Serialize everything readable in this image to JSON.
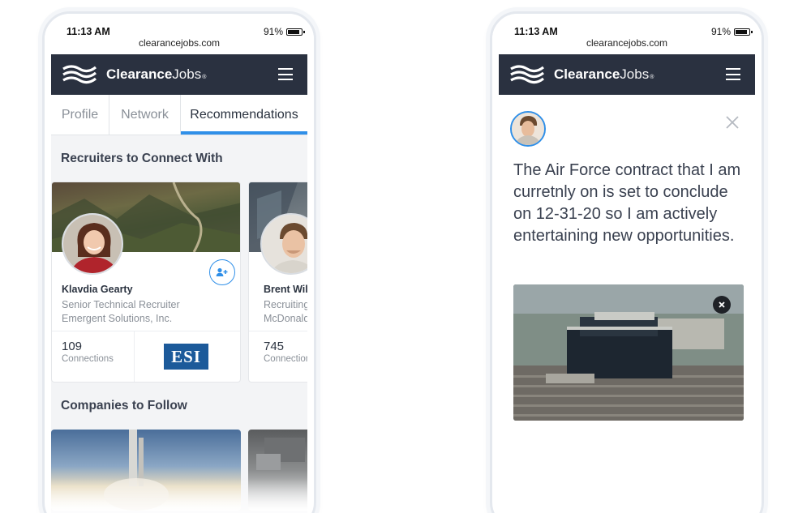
{
  "left_phone": {
    "status": {
      "time": "11:13 AM",
      "url": "clearancejobs.com",
      "battery": "91%"
    },
    "brand": {
      "name_bold": "Clearance",
      "name_light": "Jobs",
      "mark": "®"
    },
    "tabs": [
      {
        "label": "Profile"
      },
      {
        "label": "Network"
      },
      {
        "label": "Recommendations",
        "active": true
      }
    ],
    "recruiters_section": {
      "title": "Recruiters to Connect With"
    },
    "recruiters": [
      {
        "name": "Klavdia Gearty",
        "title": "Senior Technical Recruiter",
        "company": "Emergent Solutions, Inc.",
        "connections": "109",
        "connections_label": "Connections",
        "company_logo_text": "ESI"
      },
      {
        "name": "Brent Will",
        "title": "Recruiting",
        "company": "McDonald",
        "connections": "745",
        "connections_label": "Connection"
      }
    ],
    "companies_section": {
      "title": "Companies to Follow"
    }
  },
  "right_phone": {
    "status": {
      "time": "11:13 AM",
      "url": "clearancejobs.com",
      "battery": "91%"
    },
    "brand": {
      "name_bold": "Clearance",
      "name_light": "Jobs",
      "mark": "®"
    },
    "post": {
      "text": "The Air Force contract that I am curretnly on is set to conclude on 12-31-20 so I am actively entertaining new opportunities."
    }
  },
  "colors": {
    "navbar": "#2a3140",
    "accent": "#2f8fe8",
    "esi_blue": "#1c5a9a",
    "background": "#f3f4f6"
  },
  "icons": [
    "logo-flag-icon",
    "hamburger-menu-icon",
    "battery-icon",
    "add-person-icon",
    "close-icon",
    "close-circle-icon"
  ]
}
